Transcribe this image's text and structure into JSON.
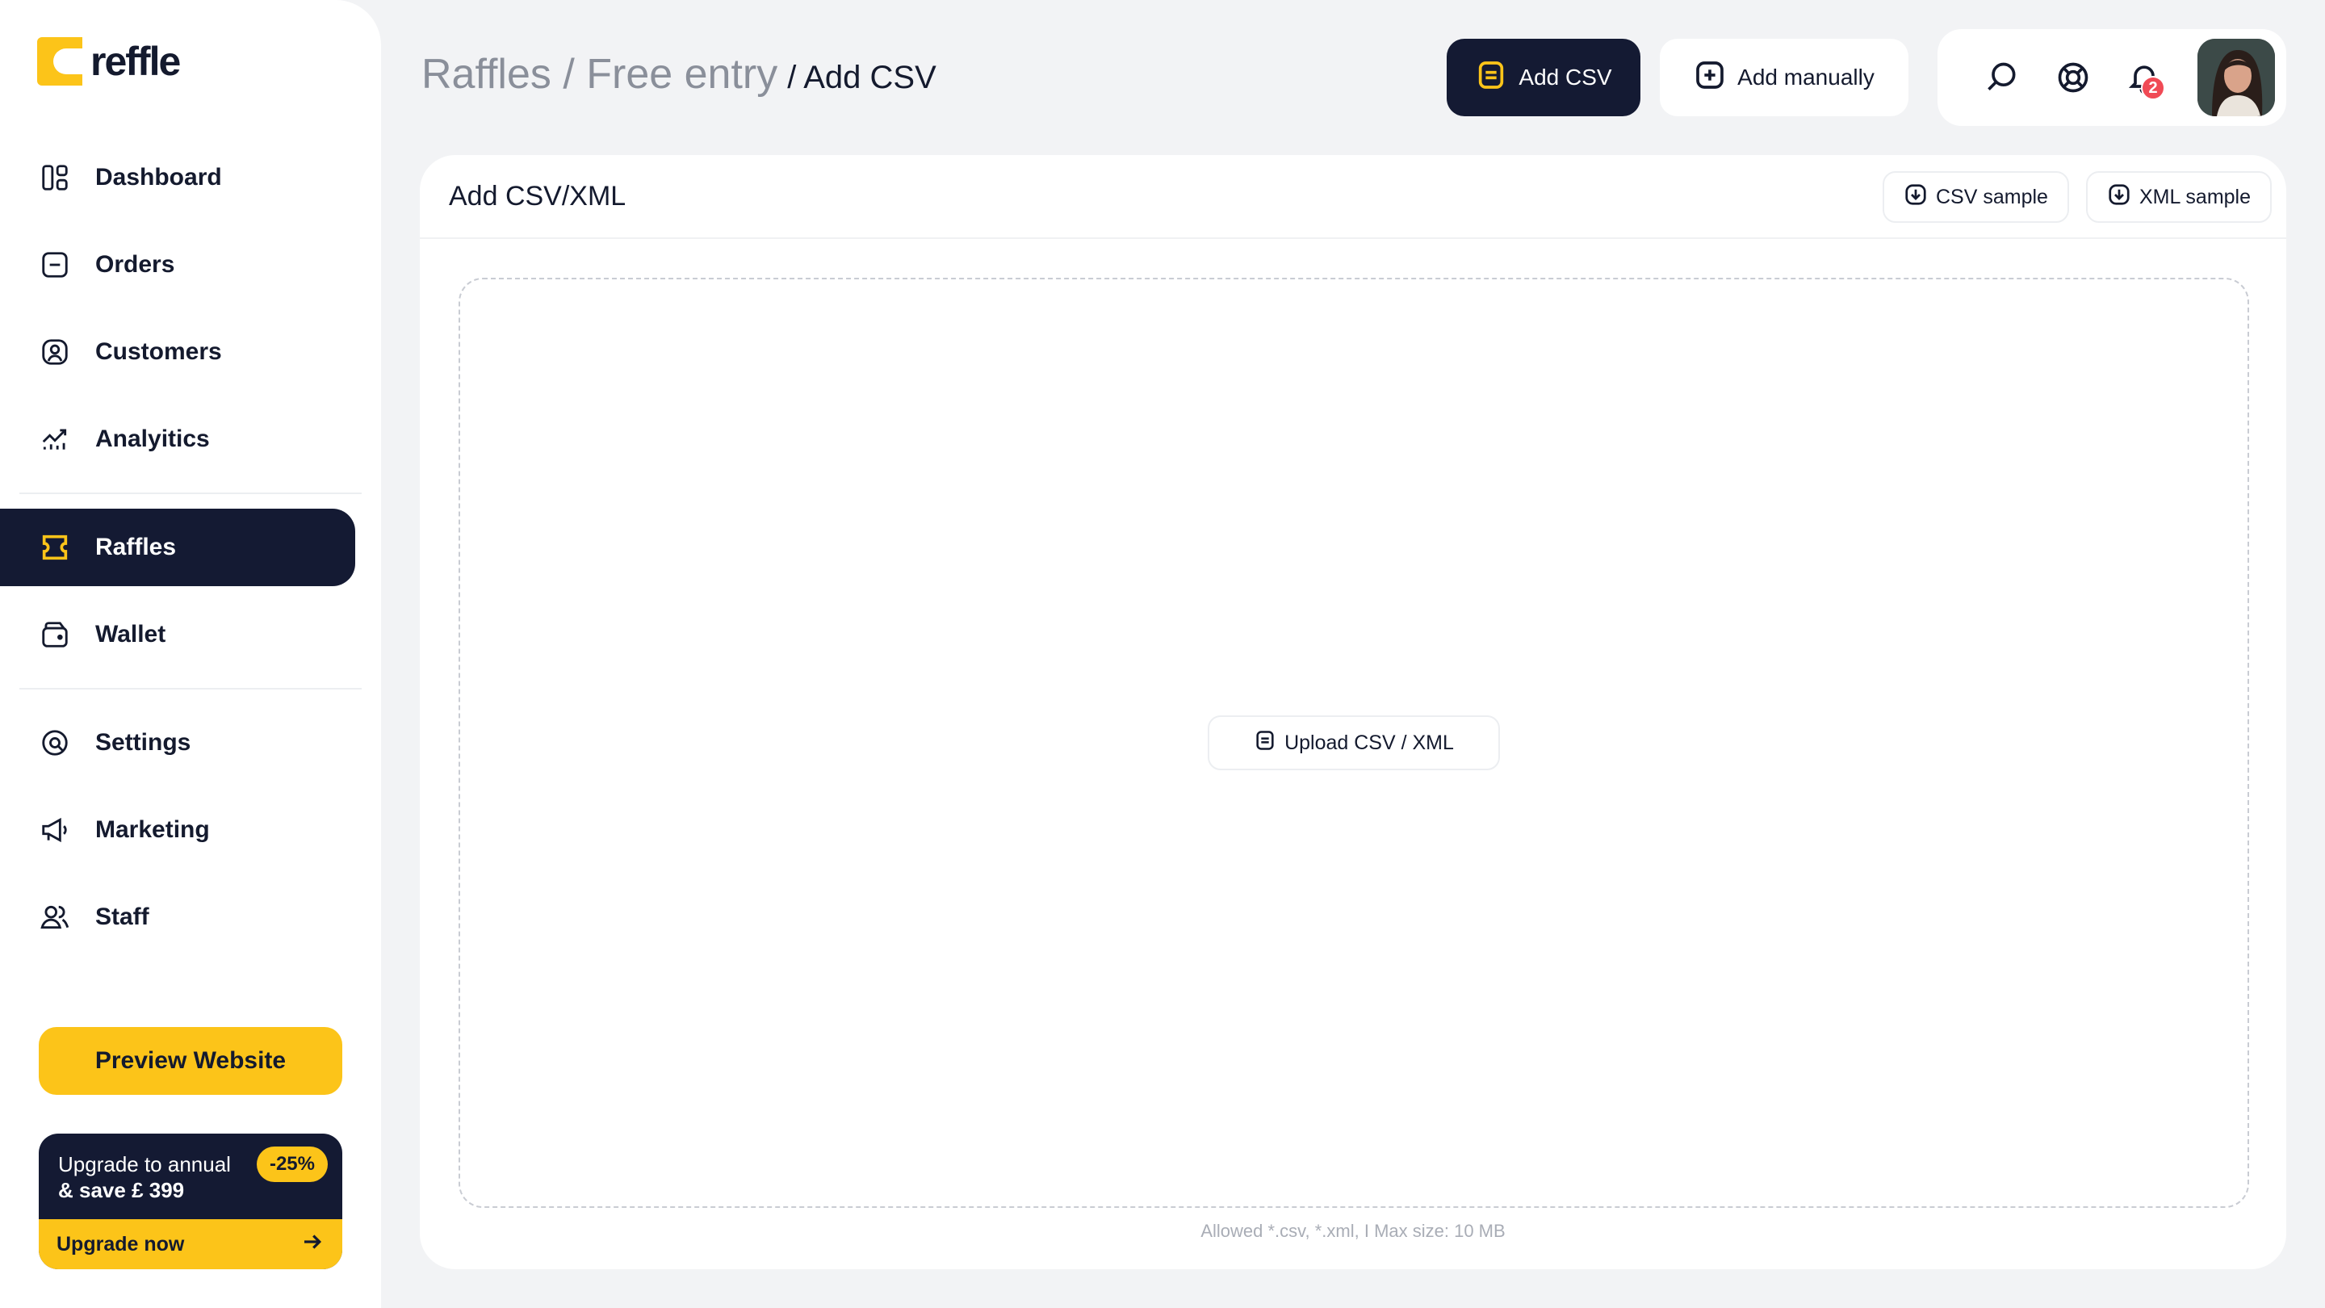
{
  "logo": {
    "text": "reffle",
    "color": "#fcc419"
  },
  "sidebar": {
    "items": [
      {
        "label": "Dashboard",
        "icon": "dashboard-grid-icon"
      },
      {
        "label": "Orders",
        "icon": "order-icon"
      },
      {
        "label": "Customers",
        "icon": "customers-icon"
      },
      {
        "label": "Analyitics",
        "icon": "analytics-icon"
      },
      {
        "label": "Raffles",
        "icon": "ticket-icon",
        "active": true
      },
      {
        "label": "Wallet",
        "icon": "wallet-icon"
      },
      {
        "label": "Settings",
        "icon": "settings-icon"
      },
      {
        "label": "Marketing",
        "icon": "megaphone-icon"
      },
      {
        "label": "Staff",
        "icon": "staff-icon"
      }
    ],
    "preview_label": "Preview Website",
    "upgrade": {
      "line1": "Upgrade to annual",
      "line2": "& save £ 399",
      "badge": "-25%",
      "cta": "Upgrade now"
    }
  },
  "header": {
    "breadcrumb_parent": "Raffles / Free entry",
    "breadcrumb_current": "/ Add CSV",
    "add_csv_label": "Add CSV",
    "add_manually_label": "Add manually",
    "notification_count": "2"
  },
  "card": {
    "title": "Add CSV/XML",
    "csv_sample_label": "CSV sample",
    "xml_sample_label": "XML sample",
    "upload_label": "Upload CSV / XML",
    "allowed_note": "Allowed *.csv, *.xml, I Max size: 10 MB"
  },
  "colors": {
    "accent": "#fcc419",
    "dark": "#141a33",
    "badge": "#f04a55"
  }
}
